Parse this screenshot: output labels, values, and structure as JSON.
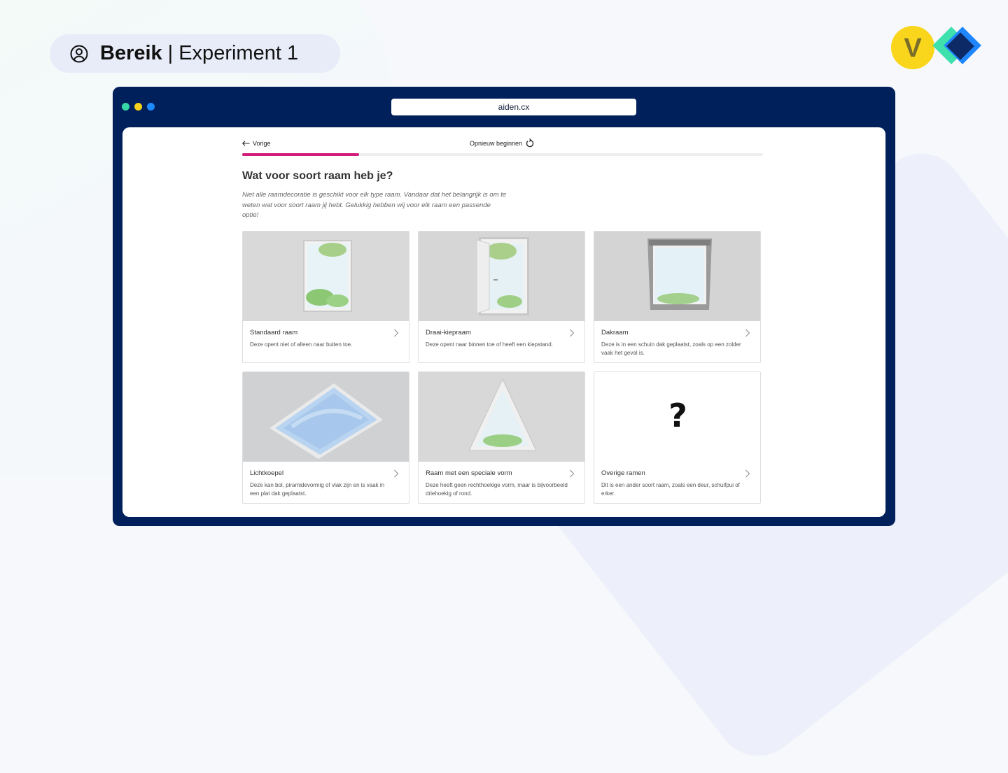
{
  "header": {
    "title_bold": "Bereik",
    "separator": "|",
    "title_rest": "Experiment 1",
    "user_icon": "user-circle-icon"
  },
  "logo": {
    "letter": "V"
  },
  "browser": {
    "url": "aiden.cx",
    "dot_colors": [
      "#36d6a6",
      "#f7d21c",
      "#1c8bff"
    ]
  },
  "nav": {
    "back_label": "Vorige",
    "restart_label": "Opnieuw beginnen"
  },
  "progress": {
    "fraction": 0.225,
    "color": "#d31b7b"
  },
  "question": {
    "title": "Wat voor soort raam heb je?",
    "intro": "Niet alle raamdecoratie is geschikt voor elk type raam. Vandaar dat het belangrijk is om te weten wat voor soort raam jij hebt. Gelukkig hebben wij voor elk raam een passende optie!"
  },
  "options": [
    {
      "title": "Standaard raam",
      "desc": "Deze opent niet of alleen naar buiten toe."
    },
    {
      "title": "Draai-kiepraam",
      "desc": "Deze opent naar binnen toe of heeft een kiepstand."
    },
    {
      "title": "Dakraam",
      "desc": "Deze is in een schuin dak geplaatst, zoals op een zolder vaak het geval is."
    },
    {
      "title": "Lichtkoepel",
      "desc": "Deze kan bol, piramidevormig of vlak zijn en is vaak in een plat dak geplaatst."
    },
    {
      "title": "Raam met een speciale vorm",
      "desc": "Deze heeft geen rechthoekige vorm, maar is bijvoorbeeld driehoekig of rond."
    },
    {
      "title": "Overige ramen",
      "desc": "Dit is een ander soort raam, zoals een deur, schuifpui of erker.",
      "symbol": "?"
    }
  ]
}
